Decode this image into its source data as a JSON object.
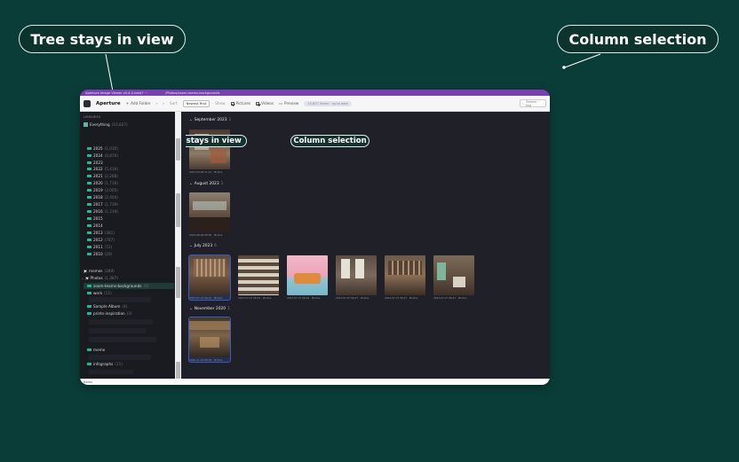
{
  "callouts": {
    "tree": "Tree stays in view",
    "column": "Column selection"
  },
  "app": {
    "titlebar_left": "Aperture Image Viewer v0.4.0-beta7  ···",
    "titlebar_path": "/Photos/zoom-teams-backgrounds",
    "name": "Aperture",
    "add_folder": "Add Folder",
    "sort_label": "Sort",
    "sort_value": "Newest first",
    "show_label": "Show",
    "pictures_label": "Pictures",
    "videos_label": "Videos",
    "preview_label": "Preview",
    "items_pill": "10,827 items · up to date",
    "search_placeholder": "Search · tag"
  },
  "sidebar": {
    "libraries_heading": "LIBRARIES",
    "everything": {
      "label": "Everything",
      "count": "(10,827)"
    },
    "years": [
      {
        "label": "2025",
        "count": "(1,035)"
      },
      {
        "label": "2024",
        "count": "(4,870)"
      },
      {
        "label": "2023",
        "count": ""
      },
      {
        "label": "2022",
        "count": "(5,434)"
      },
      {
        "label": "2021",
        "count": "(2,288)"
      },
      {
        "label": "2020",
        "count": "(1,716)"
      },
      {
        "label": "2019",
        "count": "(3,005)"
      },
      {
        "label": "2018",
        "count": "(2,404)"
      },
      {
        "label": "2017",
        "count": "(1,739)"
      },
      {
        "label": "2016",
        "count": "(1,219)"
      },
      {
        "label": "2015",
        "count": ""
      },
      {
        "label": "2014",
        "count": ""
      },
      {
        "label": "2013",
        "count": "(381)"
      },
      {
        "label": "2012",
        "count": "(787)"
      },
      {
        "label": "2011",
        "count": "(72)"
      },
      {
        "label": "2010",
        "count": "(28)"
      }
    ],
    "memes": {
      "label": "memes",
      "count": "(289)"
    },
    "photos": {
      "label": "Photos",
      "count": "(1,387)"
    },
    "photo_children": [
      {
        "label": "zoom-teams-backgrounds",
        "count": "(9)"
      },
      {
        "label": "work",
        "count": "(11)"
      },
      {
        "label": "Sample Album",
        "count": "(4)"
      },
      {
        "label": "prints-inspiration",
        "count": "(3)"
      }
    ],
    "meme": {
      "label": "meme",
      "count": ""
    },
    "infographs": {
      "label": "infographs",
      "count": "(11)"
    }
  },
  "sections": [
    {
      "title": "September 2023",
      "count": "1",
      "captions": [
        "2023-09-08 21:21 · Photos"
      ]
    },
    {
      "title": "August 2023",
      "count": "1",
      "captions": [
        "2023-08-08 08:38 · Photos"
      ]
    },
    {
      "title": "July 2023",
      "count": "6",
      "captions": [
        "2023-07-27 06:41 · Photos",
        "2023-07-27 06:44 · Photos",
        "2023-07-27 06:44 · Photos",
        "2023-07-27 06:47 · Photos",
        "2023-07-27 06:47 · Photos",
        "2023-07-27 06:47 · Photos"
      ]
    },
    {
      "title": "November 2020",
      "count": "1",
      "captions": [
        "2020-11-13 08:29 · Photos"
      ]
    }
  ],
  "status": "Items",
  "colors": {
    "background": "#0b3d38",
    "accent": "#24b79c",
    "titlebar": "#7b3fb4",
    "selection": "#3a5bc7"
  }
}
